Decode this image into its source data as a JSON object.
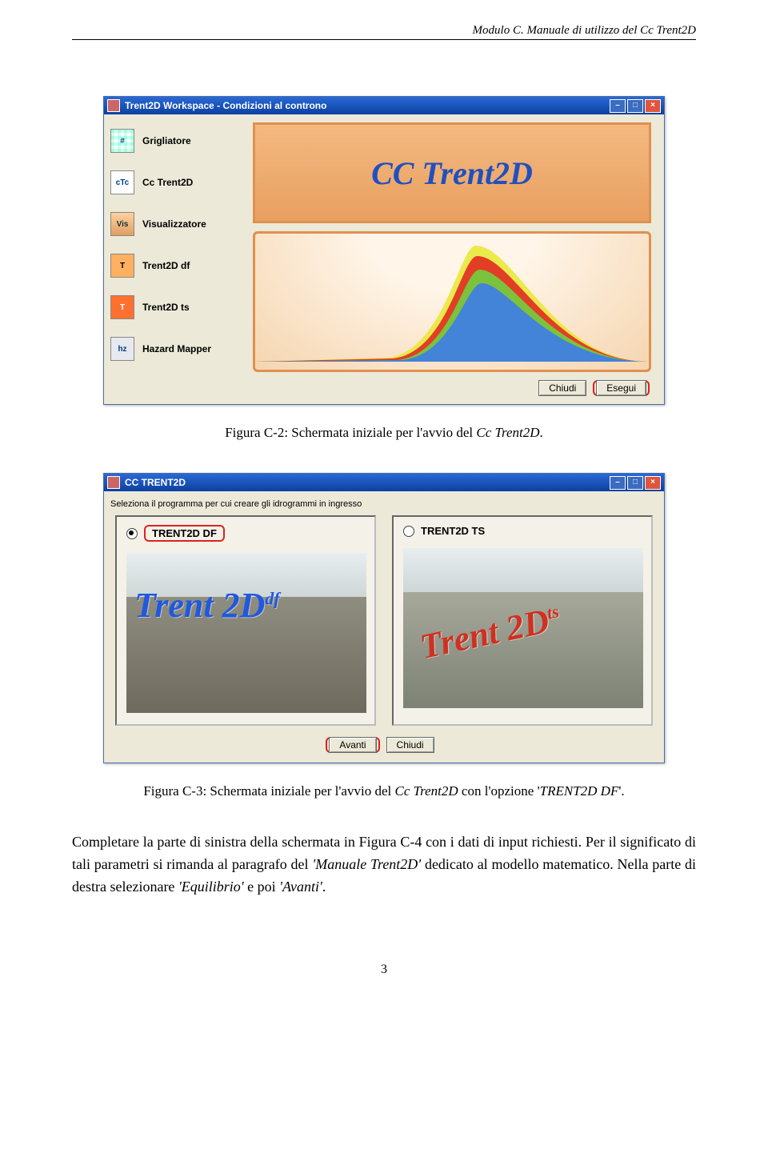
{
  "header": "Modulo C. Manuale di utilizzo del Cc Trent2D",
  "win1": {
    "title": "Trent2D Workspace - Condizioni al controno",
    "sidebar": [
      {
        "label": "Grigliatore",
        "icon": "#"
      },
      {
        "label": "Cc Trent2D",
        "icon": "cTc"
      },
      {
        "label": "Visualizzatore",
        "icon": "Vis"
      },
      {
        "label": "Trent2D df",
        "icon": "T"
      },
      {
        "label": "Trent2D ts",
        "icon": "T"
      },
      {
        "label": "Hazard Mapper",
        "icon": "hz"
      }
    ],
    "logo_text": "CC Trent2D",
    "btn_chiudi": "Chiudi",
    "btn_esegui": "Esegui",
    "tb": {
      "min": "–",
      "max": "□",
      "close": "×"
    }
  },
  "caption1_a": "Figura C-2: Schermata iniziale per l'avvio del ",
  "caption1_b": "Cc Trent2D",
  "caption1_c": ".",
  "win2": {
    "title": "CC TRENT2D",
    "instr": "Seleziona il programma per cui creare gli idrogrammi in ingresso",
    "opt_df": "TRENT2D DF",
    "opt_ts": "TRENT2D TS",
    "img_df_text": "Trent 2D",
    "img_df_sup": "df",
    "img_ts_text": "Trent 2D",
    "img_ts_sup": "ts",
    "btn_avanti": "Avanti",
    "btn_chiudi": "Chiudi",
    "tb": {
      "min": "–",
      "max": "□",
      "close": "×"
    }
  },
  "caption2_a": "Figura C-3: Schermata iniziale per l'avvio del ",
  "caption2_b": "Cc Trent2D",
  "caption2_c": " con l'opzione '",
  "caption2_d": "TRENT2D DF",
  "caption2_e": "'.",
  "para_a": "Completare la parte di sinistra della schermata in Figura C-4 con i dati di input richiesti. Per il significato di tali parametri si rimanda al paragrafo del ",
  "para_b": "'Manuale Trent2D'",
  "para_c": " dedicato al modello matematico. Nella parte di destra selezionare ",
  "para_d": "'Equilibrio'",
  "para_e": " e poi ",
  "para_f": "'Avanti'",
  "para_g": ".",
  "pagenum": "3"
}
